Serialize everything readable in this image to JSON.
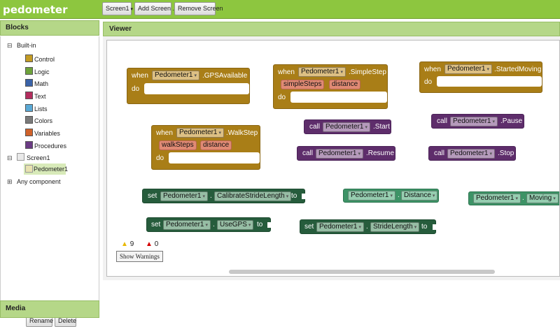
{
  "app": {
    "title": "pedometer"
  },
  "toolbar": {
    "screen_select": "Screen1",
    "add_screen": "Add Screen ...",
    "remove_screen": "Remove Screen"
  },
  "blocks_panel": {
    "title": "Blocks",
    "builtin_label": "Built-in",
    "builtin": [
      {
        "label": "Control",
        "color": "#c39b23"
      },
      {
        "label": "Logic",
        "color": "#6ea33b"
      },
      {
        "label": "Math",
        "color": "#3a63a8"
      },
      {
        "label": "Text",
        "color": "#b32d5e"
      },
      {
        "label": "Lists",
        "color": "#5aa9d6"
      },
      {
        "label": "Colors",
        "color": "#7a7a7a"
      },
      {
        "label": "Variables",
        "color": "#d0622a"
      },
      {
        "label": "Procedures",
        "color": "#6b3b84"
      }
    ],
    "screen_label": "Screen1",
    "component_label": "Pedometer1",
    "any_component": "Any component",
    "rename": "Rename",
    "delete": "Delete"
  },
  "media": {
    "title": "Media"
  },
  "viewer": {
    "title": "Viewer",
    "warnings_count": "9",
    "errors_count": "0",
    "show_warnings": "Show Warnings"
  },
  "blocks": {
    "gps": {
      "when": "when",
      "comp": "Pedometer1",
      "event": ".GPSAvailable",
      "do": "do"
    },
    "simplestep": {
      "when": "when",
      "comp": "Pedometer1",
      "event": ".SimpleStep",
      "p1": "simpleSteps",
      "p2": "distance",
      "do": "do"
    },
    "startedmoving": {
      "when": "when",
      "comp": "Pedometer1",
      "event": ".StartedMoving",
      "do": "do"
    },
    "walkstep": {
      "when": "when",
      "comp": "Pedometer1",
      "event": ".WalkStep",
      "p1": "walkSteps",
      "p2": "distance",
      "do": "do"
    },
    "call_start": {
      "call": "call",
      "comp": "Pedometer1",
      "method": ".Start"
    },
    "call_pause": {
      "call": "call",
      "comp": "Pedometer1",
      "method": ".Pause"
    },
    "call_resume": {
      "call": "call",
      "comp": "Pedometer1",
      "method": ".Resume"
    },
    "call_stop": {
      "call": "call",
      "comp": "Pedometer1",
      "method": ".Stop"
    },
    "set_calib": {
      "set": "set",
      "comp": "Pedometer1",
      "dot": ".",
      "prop": "CalibrateStrideLength",
      "to": "to"
    },
    "get_distance": {
      "comp": "Pedometer1",
      "dot": ".",
      "prop": "Distance"
    },
    "get_moving": {
      "comp": "Pedometer1",
      "dot": ".",
      "prop": "Moving"
    },
    "set_usegps": {
      "set": "set",
      "comp": "Pedometer1",
      "dot": ".",
      "prop": "UseGPS",
      "to": "to"
    },
    "set_stride": {
      "set": "set",
      "comp": "Pedometer1",
      "dot": ".",
      "prop": "StrideLength",
      "to": "to"
    }
  }
}
